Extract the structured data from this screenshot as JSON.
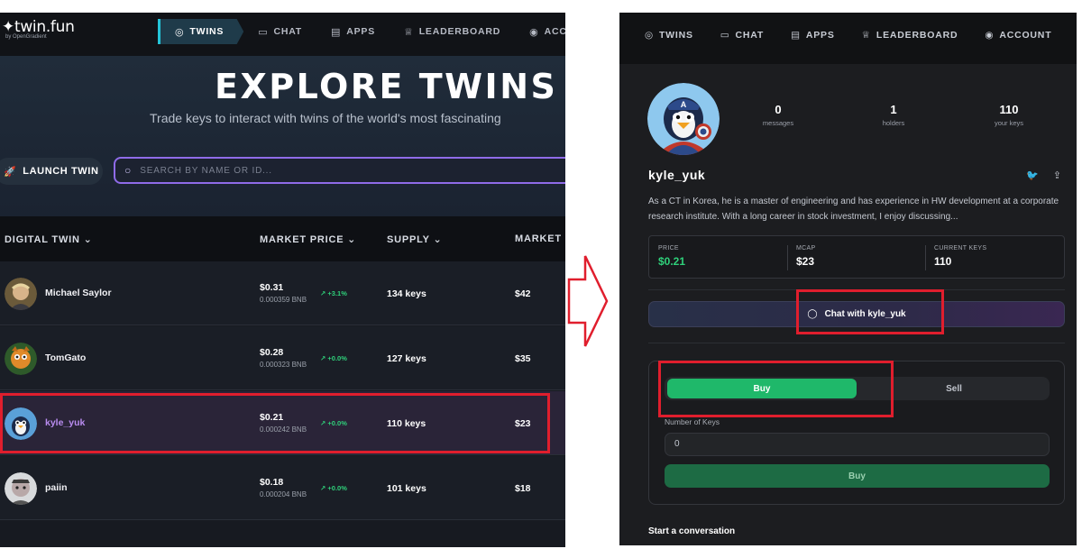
{
  "left": {
    "brand": {
      "logo": "twin.fun",
      "byline": "by OpenGradient"
    },
    "nav": [
      {
        "label": "TWINS",
        "icon": "compass-icon",
        "active": true
      },
      {
        "label": "CHAT",
        "icon": "chat-icon"
      },
      {
        "label": "APPS",
        "icon": "window-icon"
      },
      {
        "label": "LEADERBOARD",
        "icon": "trophy-icon"
      },
      {
        "label": "ACCOUNT",
        "icon": "user-circle-icon"
      }
    ],
    "hero": {
      "title": "EXPLORE TWINS",
      "subtitle": "Trade keys to interact with twins of the world's most fascinating"
    },
    "launch_label": "LAUNCH TWIN",
    "search_placeholder": "SEARCH BY NAME OR ID...",
    "columns": [
      "DIGITAL TWIN",
      "MARKET PRICE",
      "SUPPLY",
      "MARKET C"
    ],
    "rows": [
      {
        "name": "Michael Saylor",
        "price": "$0.31",
        "bnb": "0.000359 BNB",
        "change": "+3.1%",
        "supply": "134 keys",
        "cap": "$42"
      },
      {
        "name": "TomGato",
        "price": "$0.28",
        "bnb": "0.000323 BNB",
        "change": "+0.0%",
        "supply": "127 keys",
        "cap": "$35"
      },
      {
        "name": "kyle_yuk",
        "price": "$0.21",
        "bnb": "0.000242 BNB",
        "change": "+0.0%",
        "supply": "110 keys",
        "cap": "$23"
      },
      {
        "name": "paiin",
        "price": "$0.18",
        "bnb": "0.000204 BNB",
        "change": "+0.0%",
        "supply": "101 keys",
        "cap": "$18"
      }
    ]
  },
  "right": {
    "nav": [
      {
        "label": "TWINS",
        "icon": "compass-icon"
      },
      {
        "label": "CHAT",
        "icon": "chat-icon"
      },
      {
        "label": "APPS",
        "icon": "window-icon"
      },
      {
        "label": "LEADERBOARD",
        "icon": "trophy-icon"
      },
      {
        "label": "ACCOUNT",
        "icon": "user-circle-icon"
      }
    ],
    "profile": {
      "name": "kyle_yuk",
      "stats": [
        {
          "value": "0",
          "label": "messages"
        },
        {
          "value": "1",
          "label": "holders"
        },
        {
          "value": "110",
          "label": "your keys"
        }
      ],
      "bio": "As a CT in Korea, he is a master of engineering and has experience in HW development at a corporate research institute. With a long career in stock investment, I enjoy discussing..."
    },
    "market": [
      {
        "label": "PRICE",
        "value": "$0.21"
      },
      {
        "label": "MCAP",
        "value": "$23"
      },
      {
        "label": "CURRENT KEYS",
        "value": "110"
      }
    ],
    "chat_button": "Chat with kyle_yuk",
    "trade": {
      "buy_tab": "Buy",
      "sell_tab": "Sell",
      "keys_label": "Number of Keys",
      "keys_value": "0",
      "buy_button": "Buy"
    },
    "conversation_heading": "Start a conversation"
  },
  "colors": {
    "accent_purple": "#8f6be8",
    "accent_cyan": "#24c4d8",
    "positive_green": "#2fd07a",
    "buy_green": "#1fb86a",
    "annotation_red": "#e01e2d"
  }
}
